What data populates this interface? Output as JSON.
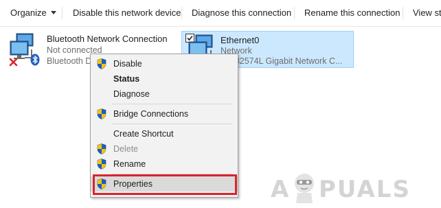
{
  "toolbar": {
    "organize": "Organize",
    "disable": "Disable this network device",
    "diagnose": "Diagnose this connection",
    "rename": "Rename this connection",
    "view_status": "View st"
  },
  "connections": [
    {
      "name": "Bluetooth Network Connection",
      "status": "Not connected",
      "device": "Bluetooth Device"
    },
    {
      "name": "Ethernet0",
      "status": "Network",
      "device": "(R) 82574L Gigabit Network C..."
    }
  ],
  "context_menu": {
    "items": [
      {
        "label": "Disable",
        "icon": "uac-shield-icon"
      },
      {
        "label": "Status"
      },
      {
        "label": "Diagnose"
      },
      {
        "label": "Bridge Connections",
        "icon": "uac-shield-icon"
      },
      {
        "label": "Create Shortcut"
      },
      {
        "label": "Delete",
        "icon": "uac-shield-icon",
        "disabled": true
      },
      {
        "label": "Rename",
        "icon": "uac-shield-icon"
      },
      {
        "label": "Properties",
        "icon": "uac-shield-icon",
        "highlighted": true
      }
    ]
  },
  "watermark": {
    "text_a": "A",
    "text_rest": "PUALS"
  },
  "colors": {
    "selection_bg": "#cce8ff",
    "selection_border": "#99d1ff",
    "highlight_box": "#d9232e",
    "bluetooth_blue": "#1f5fbf",
    "error_red": "#d9232e"
  }
}
